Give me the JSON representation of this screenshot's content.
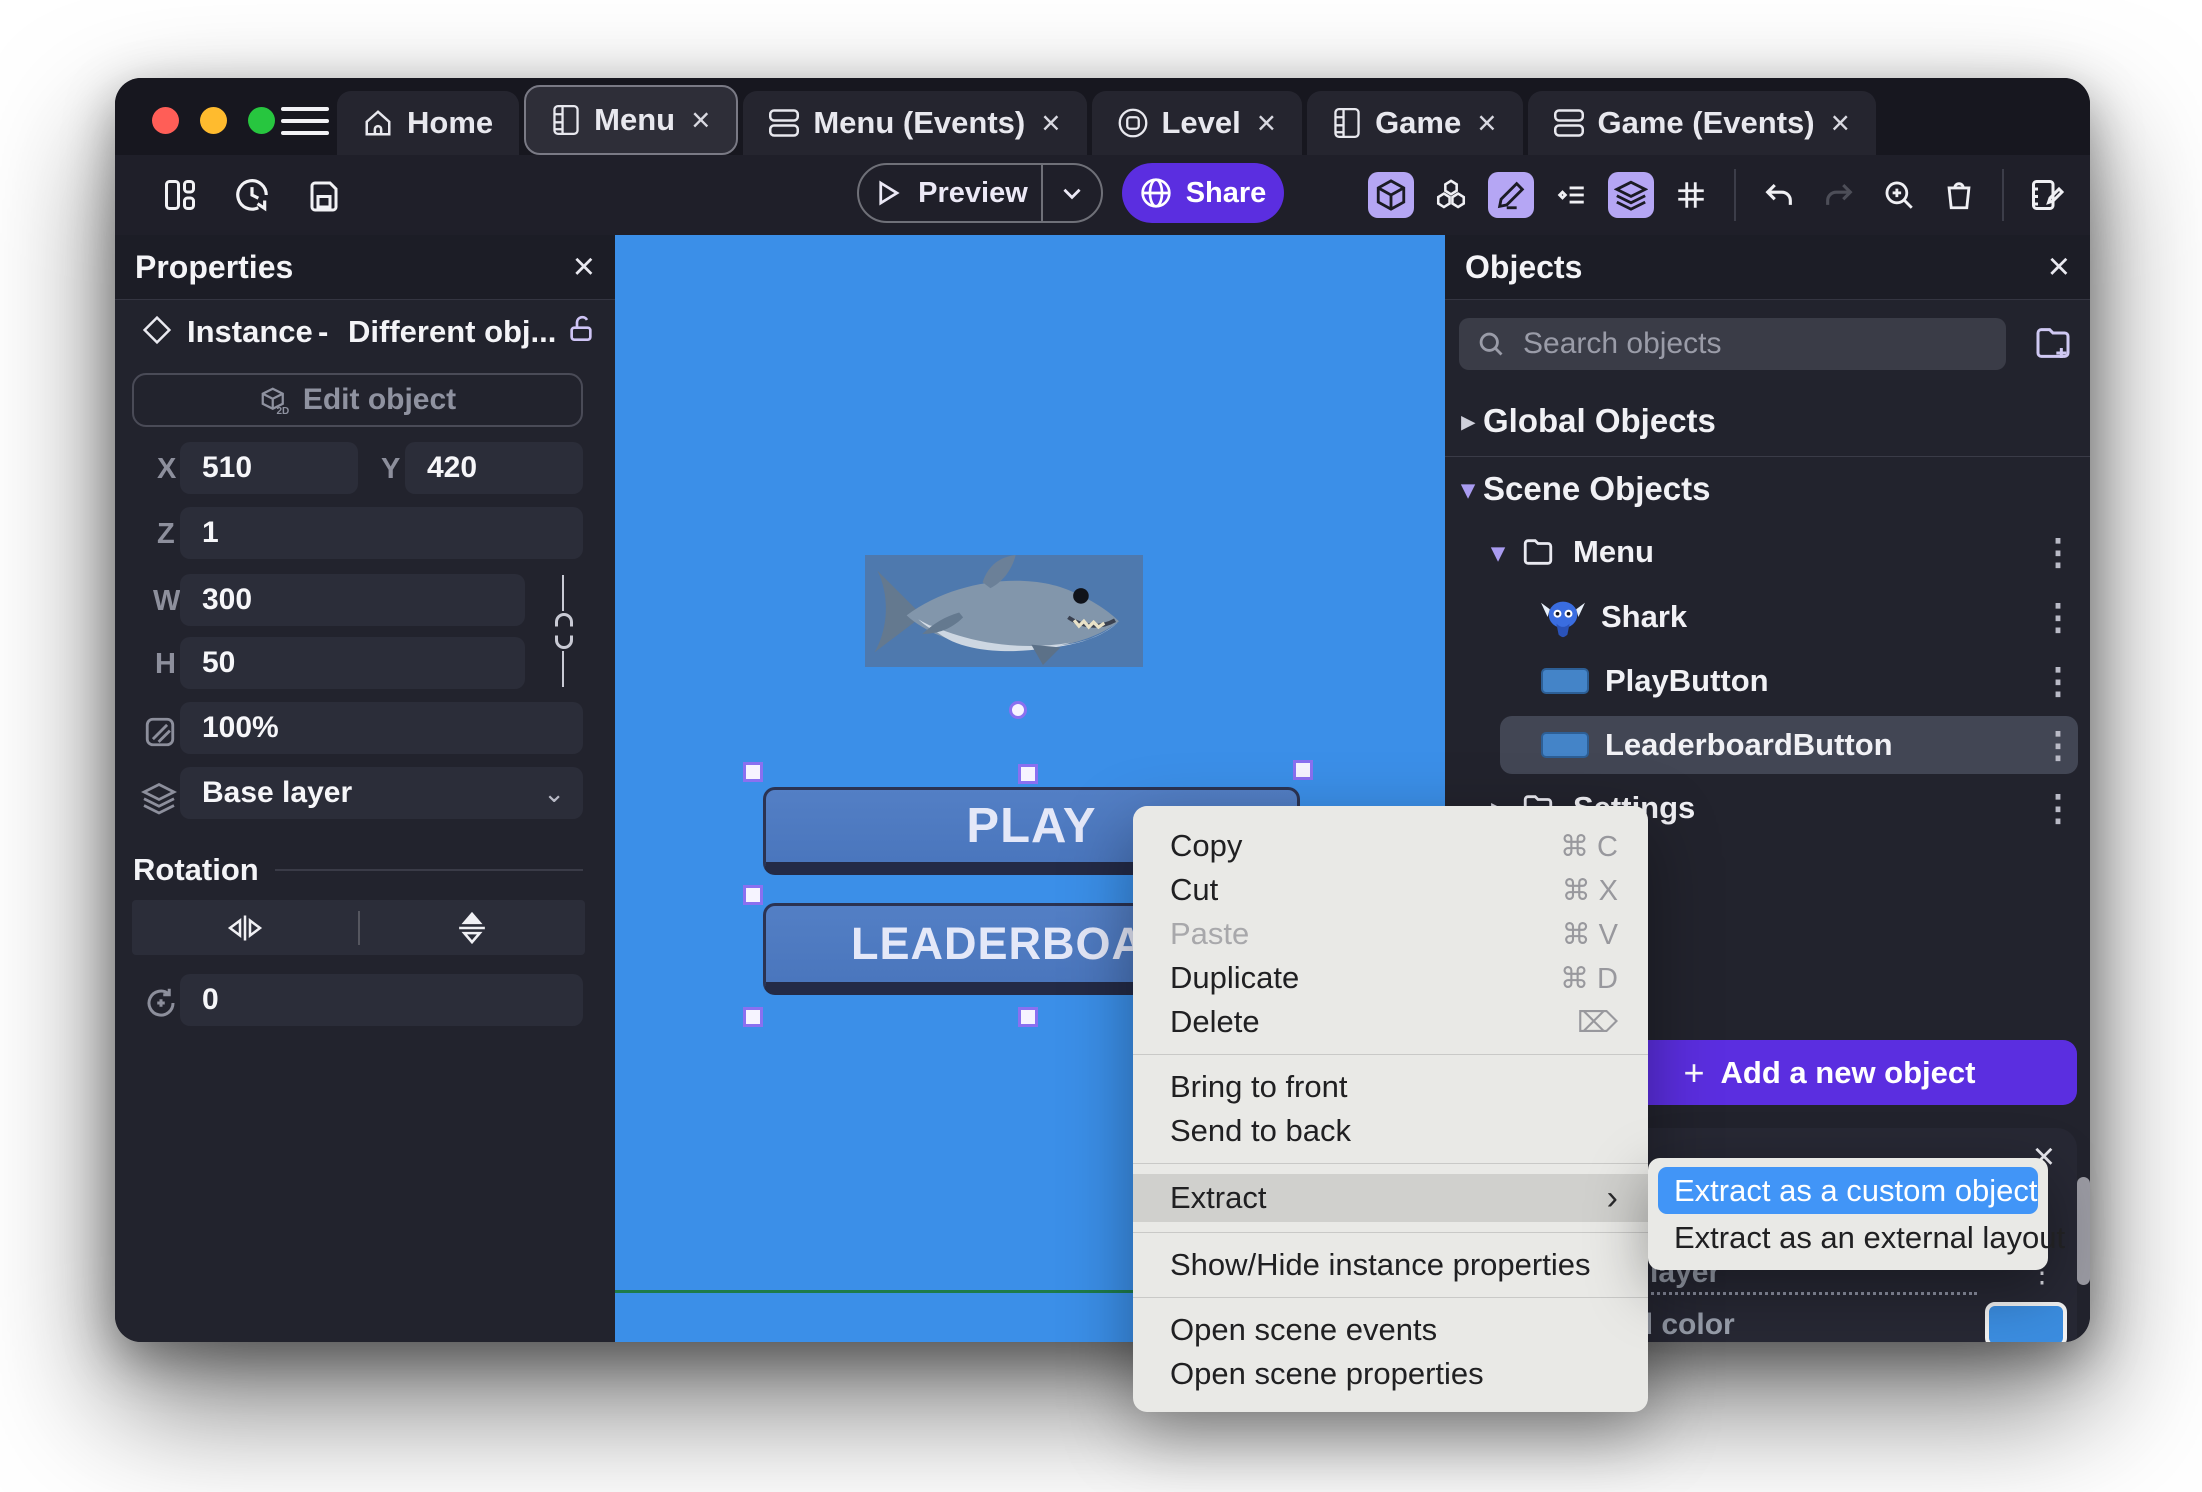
{
  "icons": {
    "close": "×",
    "kebab": "⋮",
    "plus": "+",
    "chevron_right": "›",
    "tree_collapsed": "▸",
    "tree_expanded": "▾",
    "delete_key": "⌦",
    "chevron_down": "⌄",
    "dash_sep": "-"
  },
  "tabs": [
    {
      "label": "Home"
    },
    {
      "label": "Menu"
    },
    {
      "label": "Menu (Events)"
    },
    {
      "label": "Level"
    },
    {
      "label": "Game"
    },
    {
      "label": "Game (Events)"
    }
  ],
  "toolbar": {
    "preview": "Preview",
    "share": "Share"
  },
  "properties": {
    "title": "Properties",
    "instance": "Instance",
    "object_name": "Different obj...",
    "edit_object": "Edit object",
    "x_label": "X",
    "x": "510",
    "y_label": "Y",
    "y": "420",
    "z_label": "Z",
    "z": "1",
    "w_label": "W",
    "w": "300",
    "h_label": "H",
    "h": "50",
    "opacity": "100%",
    "layer": "Base layer",
    "rotation_title": "Rotation",
    "angle": "0"
  },
  "scene": {
    "play": "PLAY",
    "leaderboard": "LEADERBOARD"
  },
  "objects": {
    "title": "Objects",
    "search_placeholder": "Search objects",
    "global": "Global Objects",
    "scene": "Scene Objects",
    "folder_menu": "Menu",
    "item_shark": "Shark",
    "item_play": "PlayButton",
    "item_leaderboard": "LeaderboardButton",
    "folder_settings": "Settings",
    "add_button": "Add a new object"
  },
  "layers_panel": {
    "layer_name": "Base layer",
    "background_color_label": "Background color"
  },
  "context_menu": {
    "copy": "Copy",
    "copy_sc": "⌘ C",
    "cut": "Cut",
    "cut_sc": "⌘ X",
    "paste": "Paste",
    "paste_sc": "⌘ V",
    "duplicate": "Duplicate",
    "duplicate_sc": "⌘ D",
    "delete": "Delete",
    "bring_to_front": "Bring to front",
    "send_to_back": "Send to back",
    "extract": "Extract",
    "show_hide": "Show/Hide instance properties",
    "open_events": "Open scene events",
    "open_props": "Open scene properties"
  },
  "submenu": {
    "custom_object": "Extract as a custom object",
    "external_layout": "Extract as an external layout"
  },
  "colors": {
    "accent_purple": "#5b2ee0",
    "canvas_blue": "#3b8fe8",
    "selection_purple": "#8a70f0",
    "menu_highlight_blue": "#4195f7",
    "background_swatch": "#3b8de0"
  }
}
